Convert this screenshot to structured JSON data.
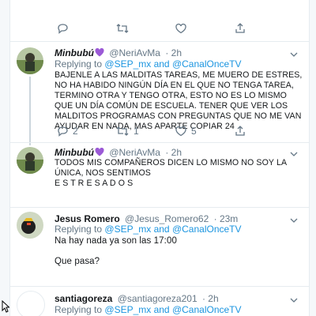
{
  "first_actions": {
    "reply": "",
    "retweet": "",
    "like": "",
    "share": ""
  },
  "tweets": [
    {
      "name": "Minbubú",
      "handle": "@NeriAvMa",
      "time": "· 2h",
      "replying_prefix": "Replying to",
      "replying_to": "@SEP_mx and @CanalOnceTV",
      "text": "BAJENLE A LAS MALDITAS TAREAS, ME MUERO DE ESTRES, NO HA HABIDO NINGÚN DÍA EN EL QUE NO TENGA TAREA, TERMINO OTRA Y TENGO OTRA, ESTO NO ES LO MISMO QUE UN DÍA COMÚN DE ESCUELA. TENER QUE VER LOS MALDITOS PROGRAMAS CON PREGUNTAS QUE NO ME VAN AYUDAR EN NADA, MAS APARTE COPIAR 24",
      "reply_count": "2",
      "retweet_count": "1",
      "like_count": "5",
      "icons": [
        "reply-icon",
        "retweet-icon",
        "like-icon",
        "share-icon"
      ]
    },
    {
      "name": "Minbubú",
      "handle": "@NeriAvMa",
      "time": "· 2h",
      "text": "TODOS MIS COMPAÑEROS DICEN LO MISMO NO SOY LA ÚNICA, NOS SENTIMOS\nE S T R E S A D O S"
    },
    {
      "name": "Jesus Romero",
      "handle": "@Jesus_Romero62",
      "time": "· 23m",
      "replying_prefix": "Replying to",
      "replying_to": "@SEP_mx and @CanalOnceTV",
      "text": "Na hay nada ya son las 17:00\n\nQue pasa?"
    },
    {
      "name": "santiagoreza",
      "handle": "@santiagoreza201",
      "time": "· 2h",
      "replying_prefix": "Replying to",
      "replying_to": "@SEP_mx and @CanalOnceTV"
    }
  ],
  "colors": {
    "link": "#1b95e0",
    "secondary": "#657786",
    "heart": "#9b59d6",
    "divider": "#e6ecf0"
  }
}
